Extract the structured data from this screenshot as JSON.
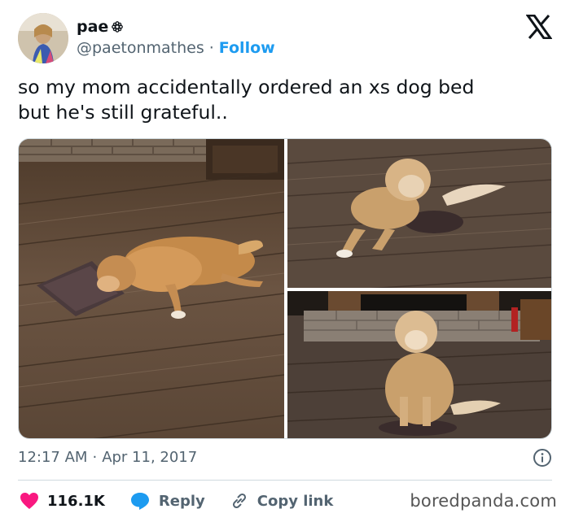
{
  "author": {
    "display_name": "pae",
    "handle": "@paetonmathes",
    "separator": "·",
    "follow_label": "Follow",
    "badge_icon": "flower-badge-icon"
  },
  "tweet": {
    "text": "so my mom accidentally ordered an xs dog bed\nbut he's still grateful.."
  },
  "media": {
    "photos": [
      {
        "icon": "dog-on-small-bed-photo"
      },
      {
        "icon": "dog-lying-on-bed-photo"
      },
      {
        "icon": "dog-sitting-on-bed-photo"
      }
    ]
  },
  "meta": {
    "time": "12:17 AM",
    "separator": "·",
    "date": "Apr 11, 2017"
  },
  "actions": {
    "likes_count": "116.1K",
    "reply_label": "Reply",
    "copy_label": "Copy link"
  },
  "watermark": "boredpanda.com",
  "colors": {
    "accent": "#1d9bf0",
    "like": "#f91880",
    "text": "#0f1419",
    "muted": "#536471"
  }
}
